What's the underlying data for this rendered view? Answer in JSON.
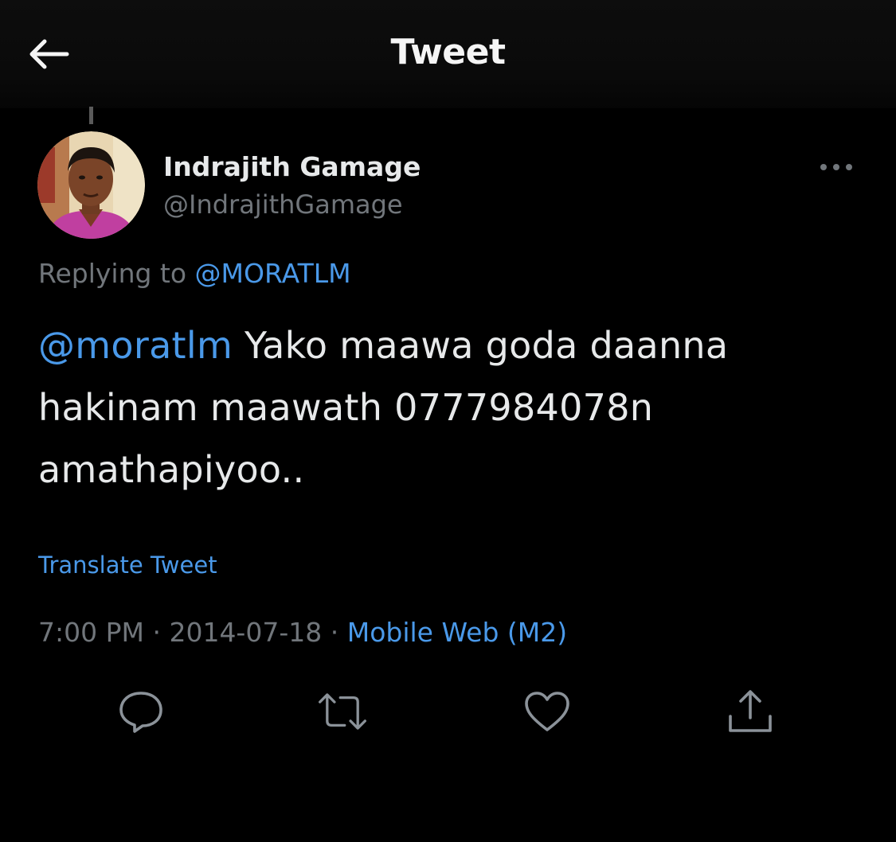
{
  "header": {
    "title": "Tweet",
    "back_icon": "arrow-left-icon"
  },
  "tweet": {
    "author": {
      "name": "Indrajith Gamage",
      "handle": "@IndrajithGamage"
    },
    "replying_to": {
      "prefix": "Replying to",
      "handle": "@MORATLM"
    },
    "text": {
      "mention": "@moratlm",
      "line1_rest": " Yako maawa goda daanna",
      "line2": "hakinam maawath 0777984078n",
      "line3": "amathapiyoo.."
    },
    "translate_label": "Translate Tweet",
    "meta": {
      "time": "7:00 PM",
      "separator": " · ",
      "date": "2014-07-18",
      "source": "Mobile Web (M2)"
    }
  },
  "actions": [
    {
      "icon": "reply-icon"
    },
    {
      "icon": "retweet-icon"
    },
    {
      "icon": "like-icon"
    },
    {
      "icon": "share-icon"
    }
  ],
  "colors": {
    "background": "#000000",
    "primary_text": "#e7e9ea",
    "secondary_text": "#71767b",
    "link": "#4a99e9"
  }
}
